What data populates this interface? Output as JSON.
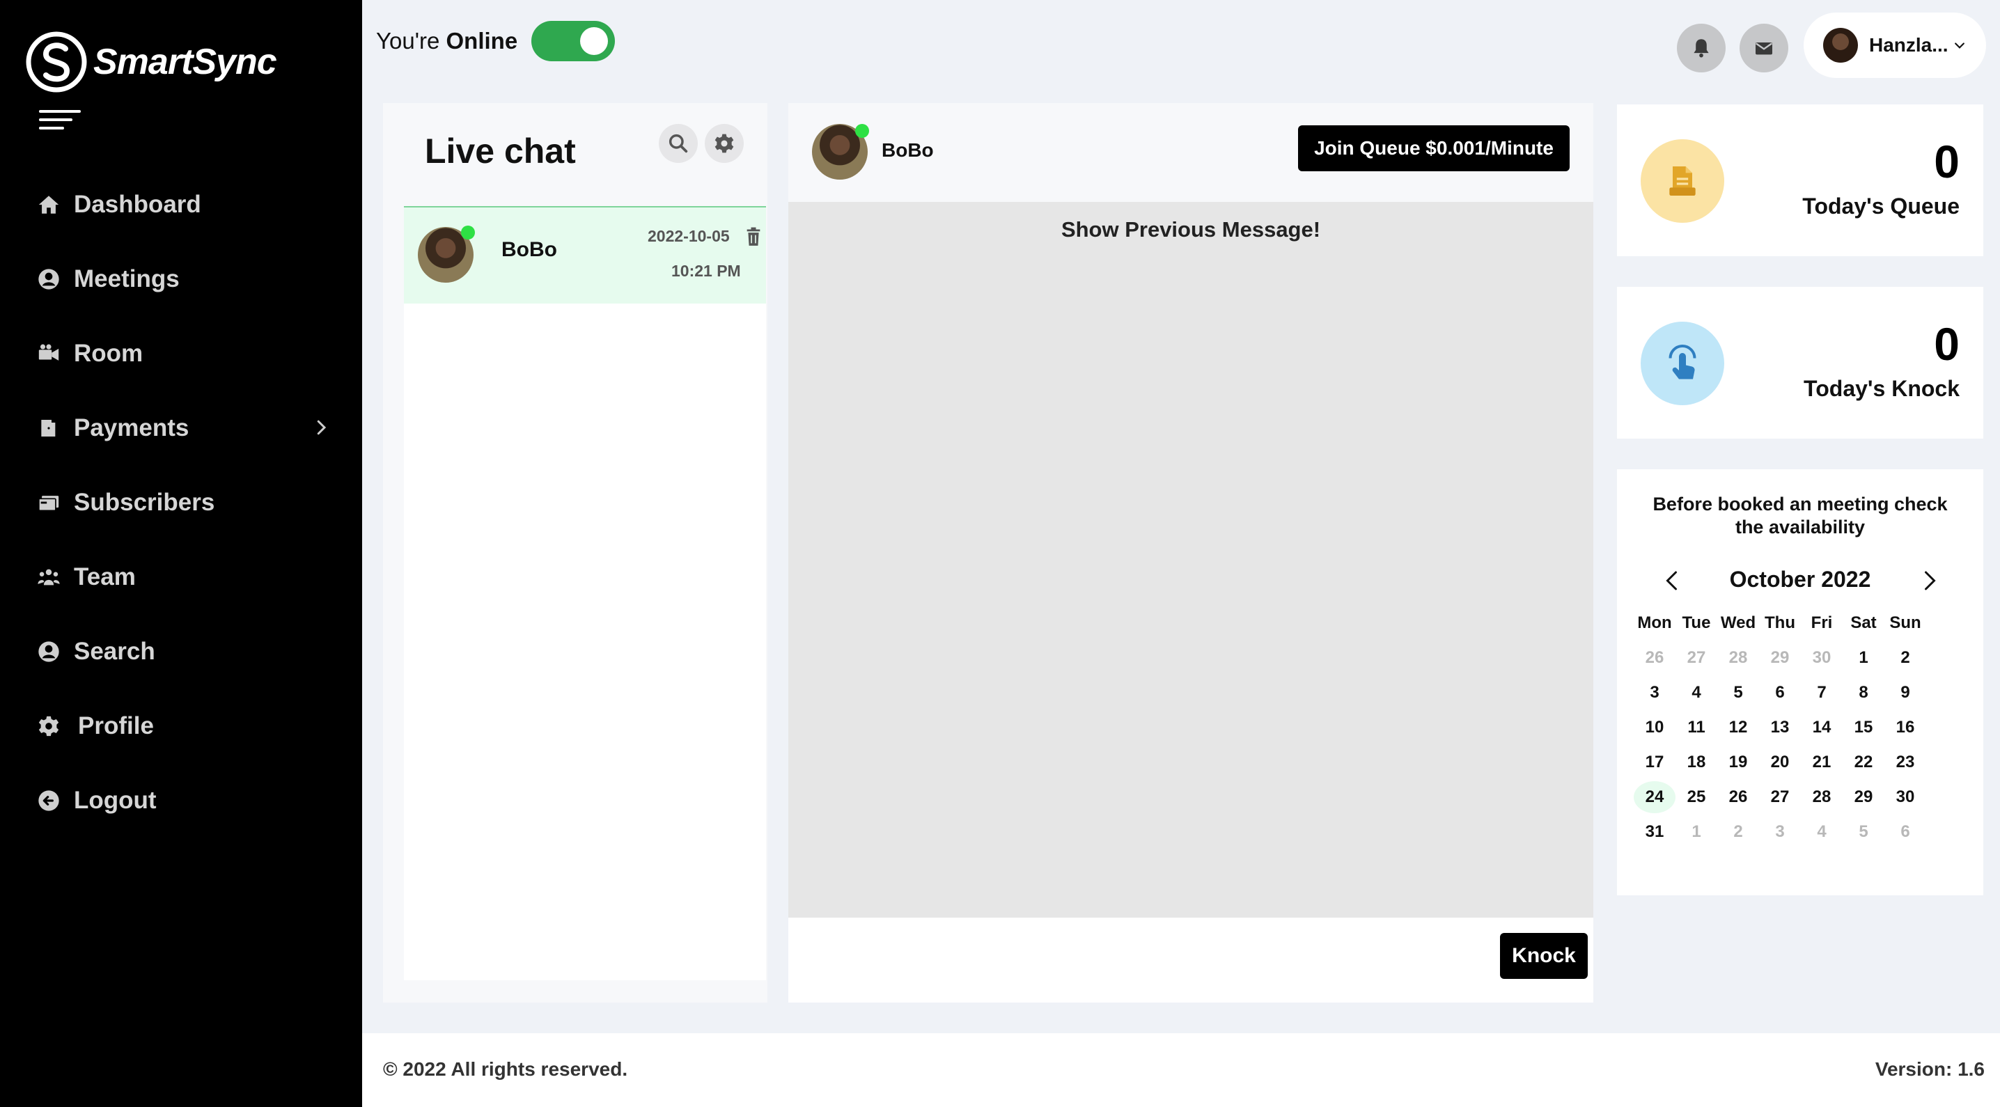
{
  "app": {
    "name": "SmartSync"
  },
  "sidebar": {
    "items": [
      {
        "label": "Dashboard",
        "icon": "home-icon"
      },
      {
        "label": "Meetings",
        "icon": "user-circle-icon"
      },
      {
        "label": "Room",
        "icon": "video-camera-icon"
      },
      {
        "label": "Payments",
        "icon": "door-icon",
        "expandable": true
      },
      {
        "label": "Subscribers",
        "icon": "cards-icon"
      },
      {
        "label": "Team",
        "icon": "team-icon"
      },
      {
        "label": "Search",
        "icon": "user-circle-icon"
      },
      {
        "label": "Profile",
        "icon": "gear-icon"
      },
      {
        "label": "Logout",
        "icon": "logout-icon"
      }
    ]
  },
  "topbar": {
    "status_prefix": "You're",
    "status_value": "Online",
    "online": true,
    "user_name": "Hanzla..."
  },
  "chat_list": {
    "title": "Live chat",
    "items": [
      {
        "name": "BoBo",
        "date": "2022-10-05",
        "time": "10:21 PM",
        "online": true,
        "selected": true
      }
    ]
  },
  "conversation": {
    "contact_name": "BoBo",
    "join_button": "Join Queue $0.001/Minute",
    "show_previous": "Show Previous Message!",
    "knock_button": "Knock"
  },
  "stats": [
    {
      "value": "0",
      "label": "Today's Queue",
      "icon": "document-icon",
      "color": "#f5d77a"
    },
    {
      "value": "0",
      "label": "Today's Knock",
      "icon": "hand-tap-icon",
      "color": "#a8ddf5"
    }
  ],
  "calendar": {
    "note": "Before booked an meeting check the availability",
    "month": "October 2022",
    "weekdays": [
      "Mon",
      "Tue",
      "Wed",
      "Thu",
      "Fri",
      "Sat",
      "Sun"
    ],
    "weeks": [
      [
        "26",
        "27",
        "28",
        "29",
        "30",
        "1",
        "2"
      ],
      [
        "3",
        "4",
        "5",
        "6",
        "7",
        "8",
        "9"
      ],
      [
        "10",
        "11",
        "12",
        "13",
        "14",
        "15",
        "16"
      ],
      [
        "17",
        "18",
        "19",
        "20",
        "21",
        "22",
        "23"
      ],
      [
        "24",
        "25",
        "26",
        "27",
        "28",
        "29",
        "30"
      ],
      [
        "31",
        "1",
        "2",
        "3",
        "4",
        "5",
        "6"
      ]
    ],
    "today": "24"
  },
  "footer": {
    "copyright": "© 2022 All rights reserved.",
    "version": "Version: 1.6"
  }
}
